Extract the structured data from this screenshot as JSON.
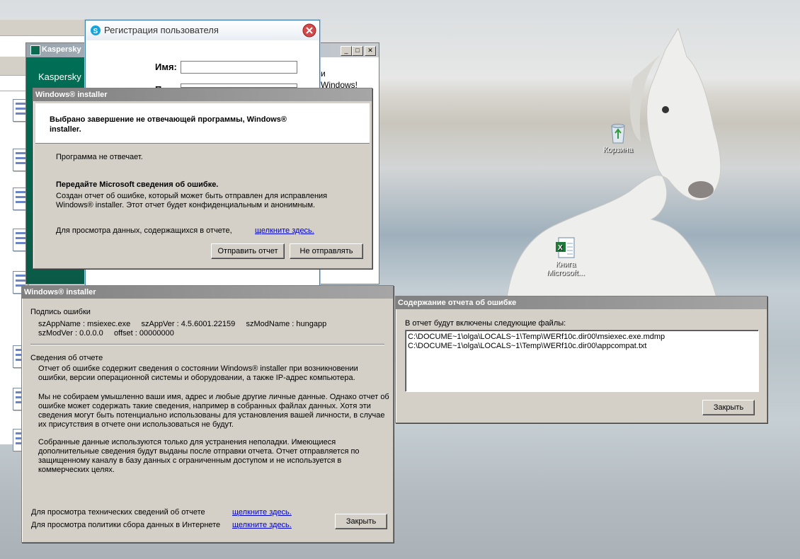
{
  "desktop": {
    "icons": [
      {
        "name": "recycle-bin",
        "label": "Корзина"
      },
      {
        "name": "excel-book",
        "label": "Книга Microsoft..."
      }
    ]
  },
  "kaspersky": {
    "title": "Kaspersky",
    "brand": "Kaspersky",
    "partial_text_1": "и",
    "partial_text_2": "Windows!"
  },
  "registration": {
    "title": "Регистрация пользователя",
    "name_label": "Имя:",
    "second_label": "Полный:",
    "name_value": ""
  },
  "wi_top": {
    "title": "Windows® installer",
    "headline": "Выбрано завершение не отвечающей программы, Windows® installer.",
    "not_responding": "Программа не отвечает.",
    "report_heading": "Передайте Microsoft сведения об ошибке.",
    "report_text_1": "Создан отчет об ошибке, который может быть отправлен для исправления",
    "report_text_2": "Windows® installer. Этот отчет будет конфиденциальным и анонимным.",
    "view_data_text": "Для просмотра данных, содержащихся в отчете,",
    "view_data_link": "щелкните здесь.",
    "send_button": "Отправить отчет",
    "dont_send_button": "Не отправлять"
  },
  "wi_details": {
    "title": "Windows® installer",
    "signature_heading": "Подпись ошибки",
    "sig_line_1": "szAppName : msiexec.exe     szAppVer : 4.5.6001.22159     szModName : hungapp",
    "sig_line_2": "szModVer : 0.0.0.0     offset : 00000000",
    "info_heading": "Сведения об отчете",
    "p1": [
      "Отчет об ошибке содержит сведения о состоянии Windows® installer при возникновении",
      "ошибки, версии операционной системы и оборудовании, а также IP-адрес компьютера."
    ],
    "p2": [
      "Мы не собираем умышленно ваши имя, адрес и любые другие личные данные. Однако отчет об",
      "ошибке может содержать такие сведения, например в собранных файлах данных. Хотя эти",
      "сведения могут быть потенциально использованы для установления вашей личности, в случае",
      "их присутствия в отчете они использоваться не будут."
    ],
    "p3": [
      "Собранные данные используются только для устранения неполадки. Имеющиеся",
      "дополнительные сведения будут выданы после отправки отчета. Отчет отправляется по",
      "защищенному каналу в базу данных с ограниченным доступом и не используется в",
      "коммерческих целях."
    ],
    "tech_text": "Для просмотра технических сведений об отчете",
    "tech_link": "щелкните здесь.",
    "policy_text": "Для просмотра политики сбора данных в Интернете",
    "policy_link": "щелкните здесь.",
    "close_button": "Закрыть"
  },
  "report_contents": {
    "title": "Содержание отчета об ошибке",
    "intro": "В отчет будут включены следующие файлы:",
    "files": [
      "C:\\DOCUME~1\\olga\\LOCALS~1\\Temp\\WERf10c.dir00\\msiexec.exe.mdmp",
      "C:\\DOCUME~1\\olga\\LOCALS~1\\Temp\\WERf10c.dir00\\appcompat.txt"
    ],
    "close_button": "Закрыть"
  }
}
